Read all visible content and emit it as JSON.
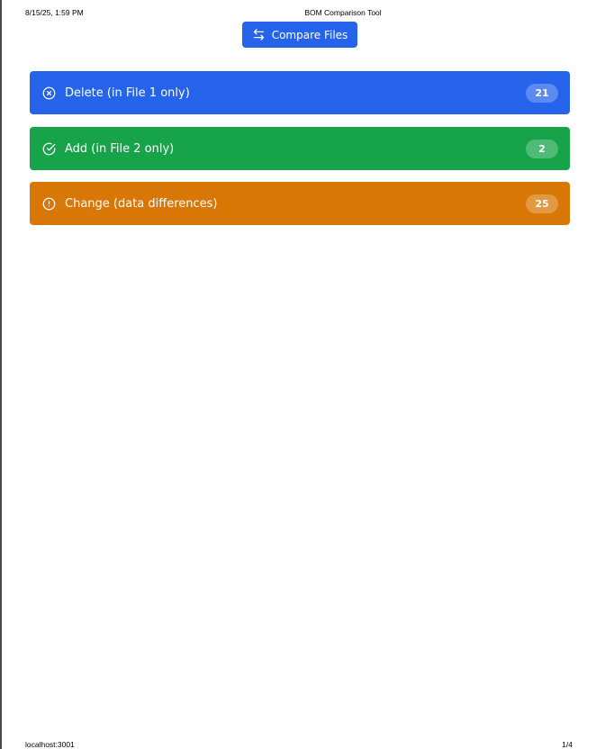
{
  "print": {
    "date": "8/15/25, 1:59 PM",
    "title": "BOM Comparison Tool",
    "url": "localhost:3001",
    "page": "1/4"
  },
  "toolbar": {
    "compare_label": "Compare Files",
    "compare_icon": "arrows-left-right-icon"
  },
  "sections": [
    {
      "label": "Delete (in File 1 only)",
      "count": "21",
      "icon": "x-circle-icon",
      "color": "#2563eb"
    },
    {
      "label": "Add (in File 2 only)",
      "count": "2",
      "icon": "check-circle-icon",
      "color": "#16a34a"
    },
    {
      "label": "Change (data differences)",
      "count": "25",
      "icon": "alert-circle-icon",
      "color": "#d97706"
    }
  ]
}
